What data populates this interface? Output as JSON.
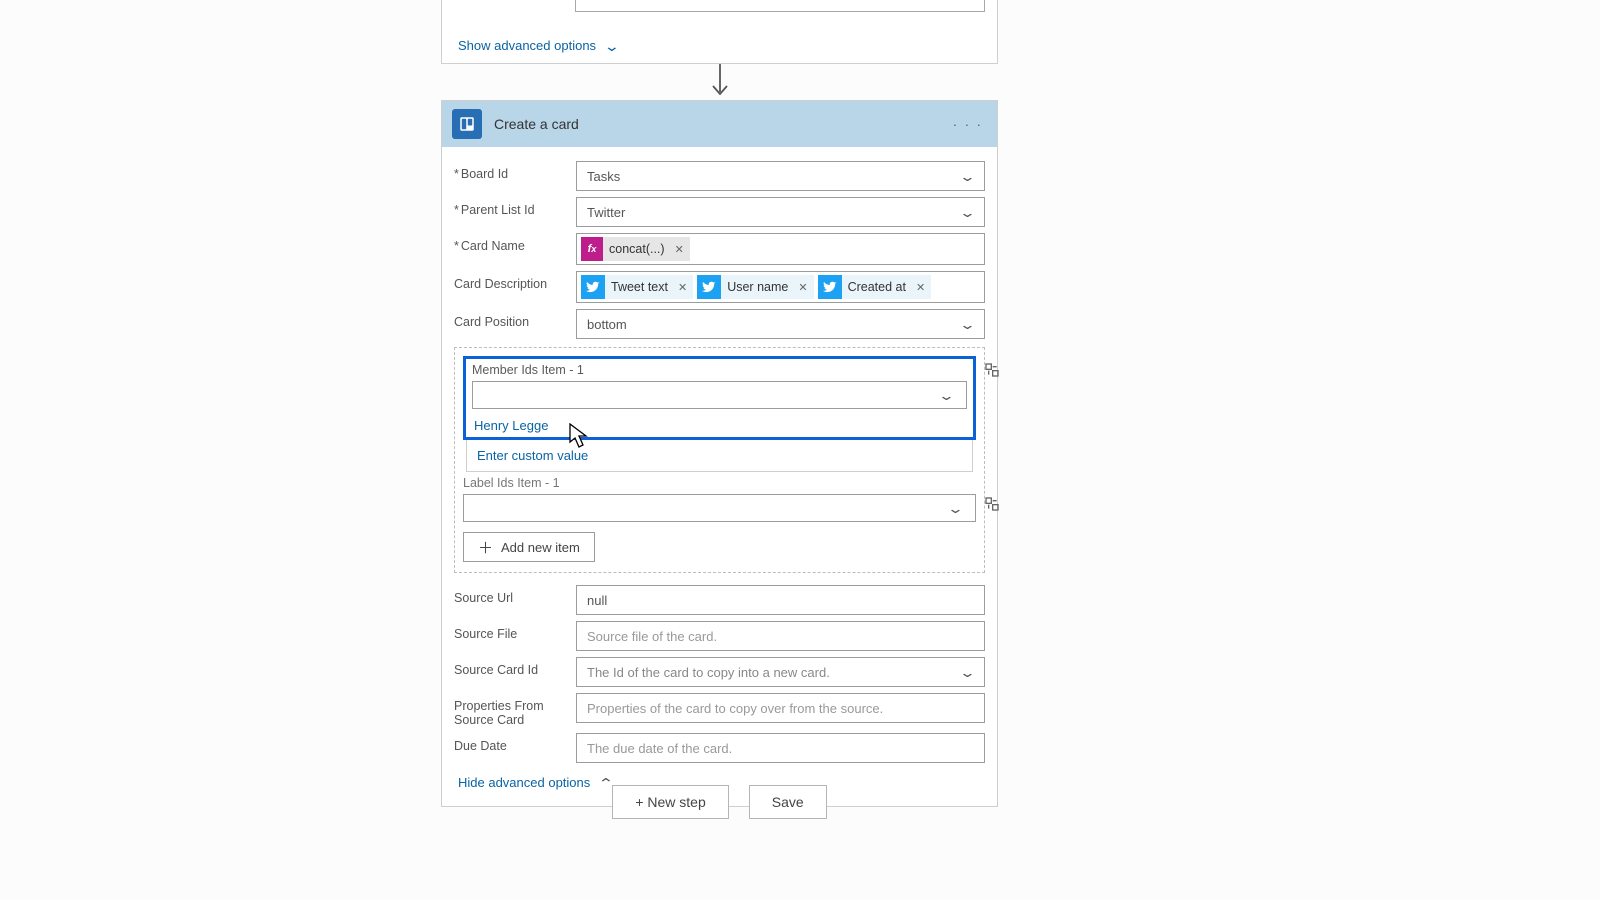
{
  "prev_card": {
    "advanced_toggle": "Show advanced options"
  },
  "card": {
    "title": "Create a card",
    "menu": "· · ·",
    "fields": {
      "board": {
        "label": "Board Id",
        "value": "Tasks"
      },
      "parent_list": {
        "label": "Parent List Id",
        "value": "Twitter"
      },
      "card_name": {
        "label": "Card Name",
        "fx_token": "concat(...)"
      },
      "card_desc": {
        "label": "Card Description",
        "tokens": [
          "Tweet text",
          "User name",
          "Created at"
        ]
      },
      "card_position": {
        "label": "Card Position",
        "value": "bottom"
      },
      "member_group": {
        "label": "Member Ids Item - 1",
        "option_person": "Henry Legge",
        "option_custom": "Enter custom value",
        "label_ids_label": "Label Ids Item - 1",
        "add_new": "Add new item"
      },
      "source_url": {
        "label": "Source Url",
        "value": "null"
      },
      "source_file": {
        "label": "Source File",
        "placeholder": "Source file of the card."
      },
      "source_card": {
        "label": "Source Card Id",
        "placeholder": "The Id of the card to copy into a new card."
      },
      "props_source": {
        "label": "Properties From Source Card",
        "placeholder": "Properties of the card to copy over from the source."
      },
      "due_date": {
        "label": "Due Date",
        "placeholder": "The due date of the card."
      }
    },
    "hide_advanced": "Hide advanced options"
  },
  "footer": {
    "new_step": "+ New step",
    "save": "Save"
  },
  "icons": {
    "trello": "trello-icon",
    "fx": "fx-icon",
    "twitter": "twitter-icon",
    "chevron": "chevron-down-icon",
    "toggle": "toggle-dynamic-icon"
  }
}
